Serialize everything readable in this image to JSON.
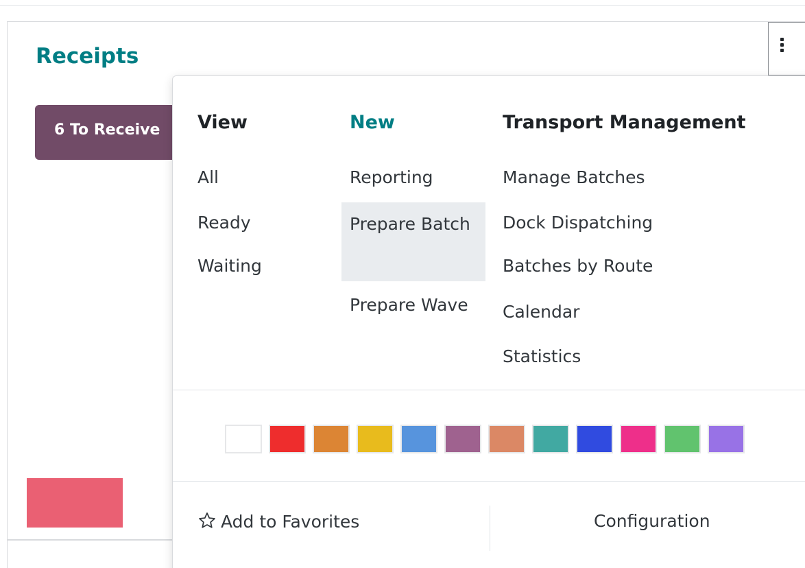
{
  "card": {
    "title": "Receipts",
    "receive_button_label": "6 To Receive",
    "colors": {
      "title": "#017e84",
      "receive_button": "#714b67",
      "progress_chip": "#ea6073"
    }
  },
  "kebab_icon": "vertical-ellipsis-icon",
  "dropdown": {
    "view": {
      "header": "View",
      "items": [
        "All",
        "Ready",
        "Waiting"
      ]
    },
    "new": {
      "header": "New",
      "items": [
        "Reporting",
        "Prepare Batch",
        "Prepare Wave"
      ],
      "active_item": "Prepare Batch"
    },
    "transport": {
      "header": "Transport Management",
      "items": [
        "Manage Batches",
        "Dock Dispatching",
        "Batches by Route",
        "Calendar",
        "Statistics"
      ]
    },
    "color_swatches": [
      "#ffffff",
      "#ee2d2d",
      "#dc8534",
      "#e8bb1d",
      "#5794dd",
      "#9f628f",
      "#db8865",
      "#41a9a2",
      "#304be0",
      "#ee2f8a",
      "#61c36e",
      "#9872e6"
    ],
    "footer": {
      "favorites_label": "Add to Favorites",
      "favorites_icon": "star-outline-icon",
      "configuration_label": "Configuration"
    }
  }
}
